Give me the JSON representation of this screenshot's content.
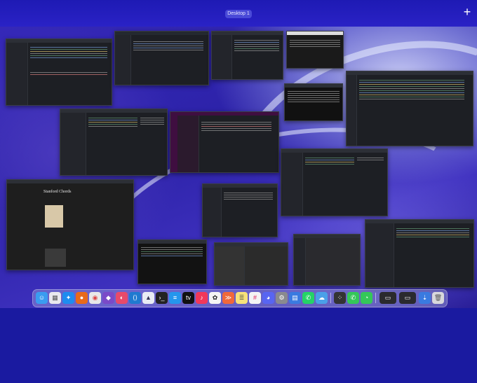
{
  "mission_control": {
    "desktop_label": "Desktop 1",
    "add_desktop_glyph": "+"
  },
  "windows": {
    "web_page": {
      "title": "Stanford Chords"
    }
  },
  "dock": {
    "apps": [
      "finder-icon",
      "launchpad-icon",
      "safari-icon",
      "firefox-icon",
      "chrome-icon",
      "github-desktop-icon",
      "arc-icon",
      "vscode-icon",
      "arrow-app-icon",
      "terminal-icon",
      "docker-icon",
      "apple-tv-icon",
      "music-icon",
      "chatgpt-icon",
      "swift-icon",
      "notes-icon",
      "slack-icon",
      "discord-icon",
      "system-settings-icon",
      "files-icon",
      "whatsapp-icon",
      "weather-icon",
      "phone-icon",
      "messages-icon"
    ],
    "accent": "#2b2bd0"
  }
}
